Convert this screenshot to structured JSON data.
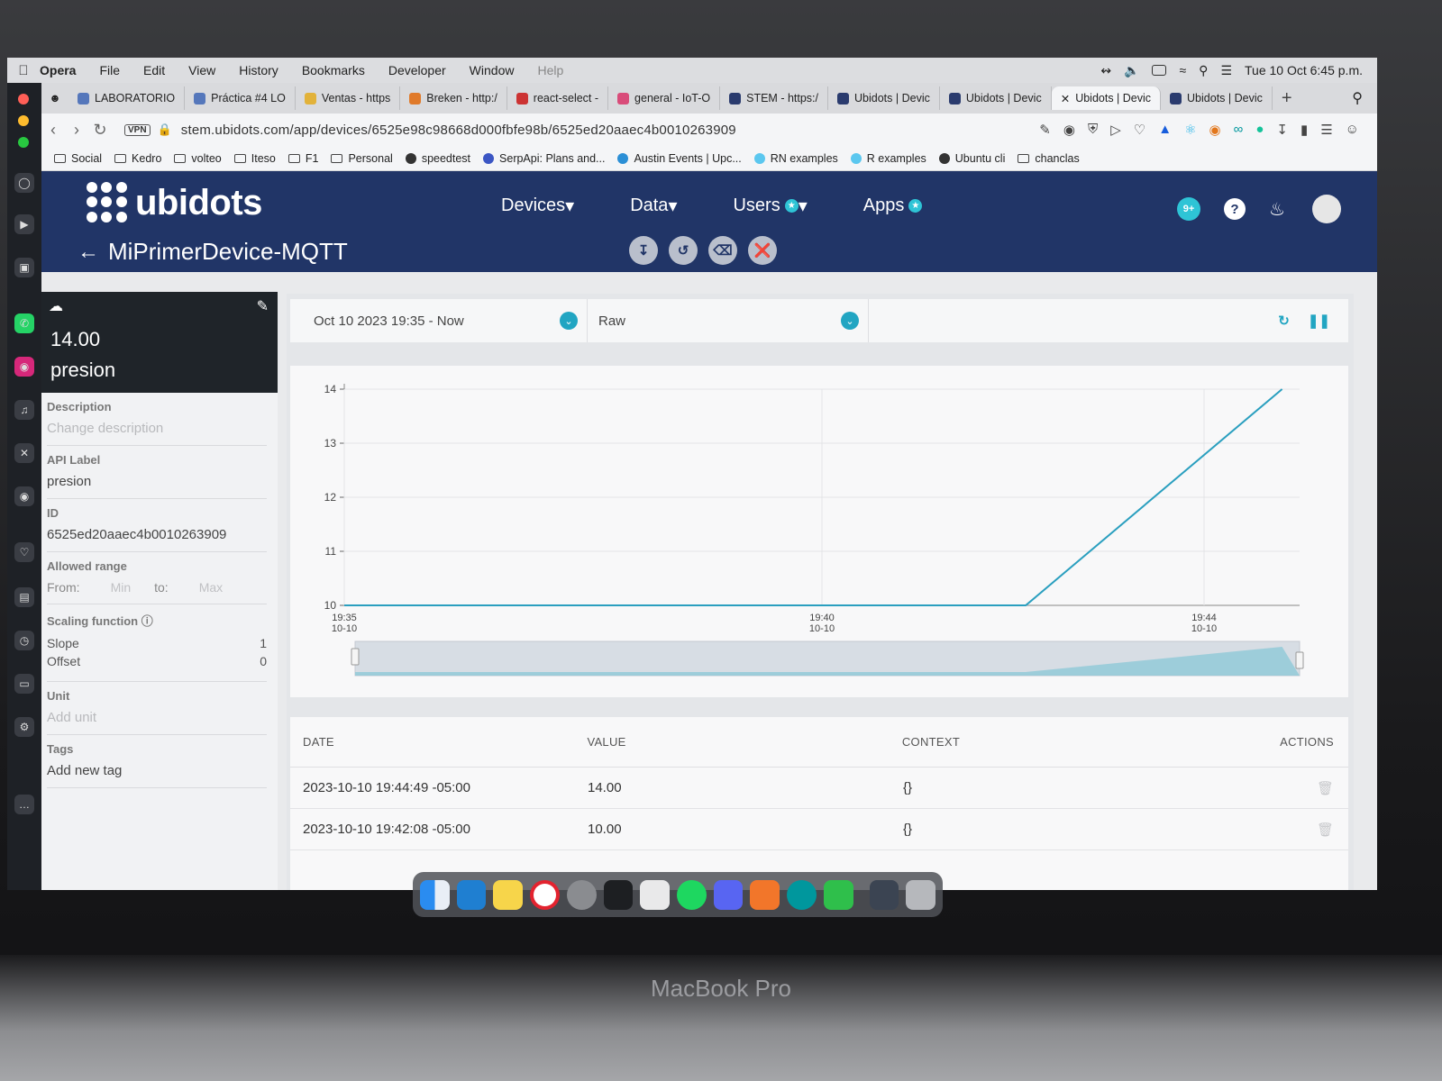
{
  "menubar": {
    "app": "Opera",
    "items": [
      "File",
      "Edit",
      "View",
      "History",
      "Bookmarks",
      "Developer",
      "Window",
      "Help"
    ],
    "datetime": "Tue 10 Oct  6:45 p.m."
  },
  "tabs": [
    {
      "label": "LABORATORIO",
      "color": "#5577bb"
    },
    {
      "label": "Práctica #4 LO",
      "color": "#5577bb"
    },
    {
      "label": "Ventas - https",
      "color": "#e2b23a"
    },
    {
      "label": "Breken - http:/",
      "color": "#e07a2a"
    },
    {
      "label": "react-select -",
      "color": "#c33"
    },
    {
      "label": "general - IoT-O",
      "color": "#d94c7a"
    },
    {
      "label": "STEM - https:/",
      "color": "#2a3b6e"
    },
    {
      "label": "Ubidots | Devic",
      "color": "#2a3b6e"
    },
    {
      "label": "Ubidots | Devic",
      "color": "#2a3b6e"
    },
    {
      "label": "Ubidots | Devic",
      "color": "#2a3b6e",
      "active": true
    },
    {
      "label": "Ubidots | Devic",
      "color": "#2a3b6e"
    }
  ],
  "address": {
    "vpn": "VPN",
    "url": "stem.ubidots.com/app/devices/6525e98c98668d000fbfe98b/6525ed20aaec4b0010263909"
  },
  "bookmarks": [
    "Social",
    "Kedro",
    "volteo",
    "Iteso",
    "F1",
    "Personal",
    "speedtest",
    "SerpApi: Plans and...",
    "Austin Events | Upc...",
    "RN examples",
    "R examples",
    "Ubuntu cli",
    "chanclas"
  ],
  "header": {
    "logo": "ubidots",
    "nav": [
      "Devices",
      "Data",
      "Users",
      "Apps"
    ],
    "notifications": "9+",
    "help": "?"
  },
  "device": {
    "name": "MiPrimerDevice-MQTT"
  },
  "variable": {
    "value": "14.00",
    "name": "presion",
    "description_label": "Description",
    "description_placeholder": "Change description",
    "api_label_label": "API Label",
    "api_label": "presion",
    "id_label": "ID",
    "id": "6525ed20aaec4b0010263909",
    "range_label": "Allowed range",
    "range_from": "From:",
    "range_min": "Min",
    "range_to": "to:",
    "range_max": "Max",
    "scaling_label": "Scaling function",
    "slope_label": "Slope",
    "slope": "1",
    "offset_label": "Offset",
    "offset": "0",
    "unit_label": "Unit",
    "unit_placeholder": "Add unit",
    "tags_label": "Tags",
    "tags_add": "Add new tag"
  },
  "filters": {
    "date_range": "Oct 10 2023 19:35 - Now",
    "aggregation": "Raw"
  },
  "chart_data": {
    "type": "line",
    "x": [
      "19:35",
      "19:42:08",
      "19:44:49"
    ],
    "y": [
      10,
      10,
      14
    ],
    "ylim": [
      10,
      14
    ],
    "yticks": [
      "10",
      "11",
      "12",
      "13",
      "14"
    ],
    "xticks": [
      {
        "time": "19:35",
        "date": "10-10"
      },
      {
        "time": "19:40",
        "date": "10-10"
      },
      {
        "time": "19:44",
        "date": "10-10"
      }
    ],
    "color": "#2a9fbf",
    "grid": true
  },
  "table": {
    "headers": [
      "DATE",
      "VALUE",
      "CONTEXT",
      "ACTIONS"
    ],
    "rows": [
      {
        "date": "2023-10-10 19:44:49 -05:00",
        "value": "14.00",
        "context": "{}"
      },
      {
        "date": "2023-10-10 19:42:08 -05:00",
        "value": "10.00",
        "context": "{}"
      }
    ]
  },
  "laptop": {
    "model": "MacBook Pro"
  }
}
